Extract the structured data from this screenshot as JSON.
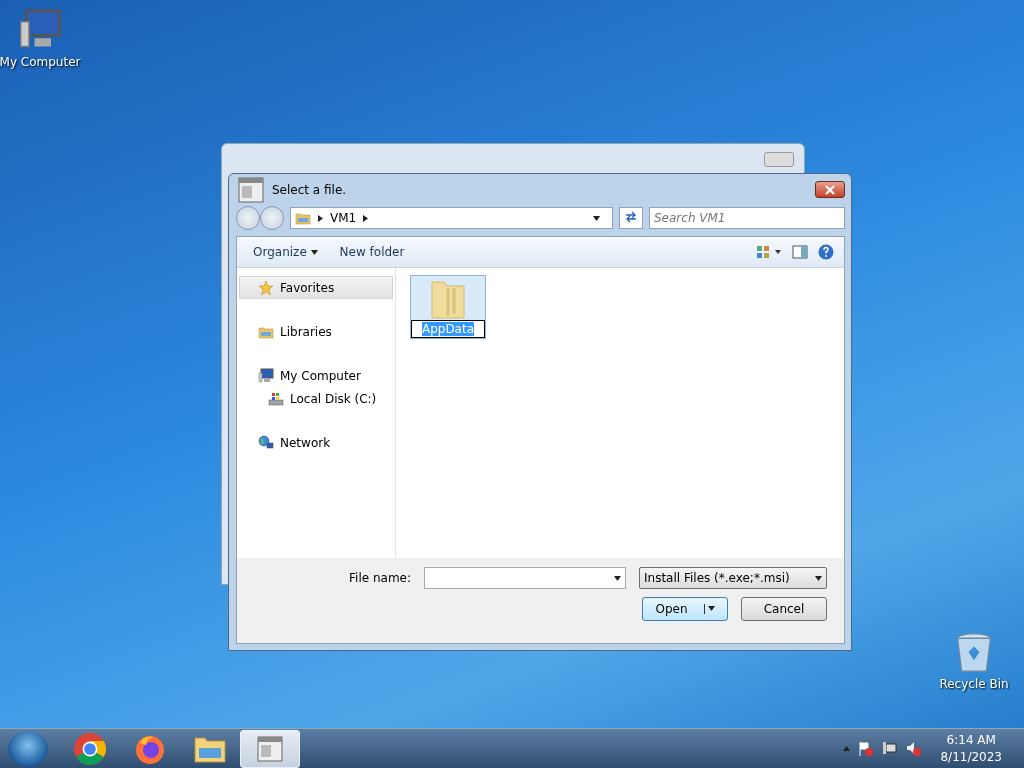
{
  "desktop_icons": [
    {
      "label": "My Computer",
      "kind": "computer"
    },
    {
      "label": "Recycle Bin",
      "kind": "recycle"
    }
  ],
  "dialog": {
    "title": "Select a file.",
    "breadcrumb": [
      "VM1"
    ],
    "search": {
      "placeholder": "Search VM1"
    },
    "toolbar": {
      "organize": "Organize",
      "new_folder": "New folder"
    },
    "nav": [
      {
        "label": "Favorites",
        "kind": "favorites",
        "selected": true
      },
      {
        "label": "Libraries",
        "kind": "libraries",
        "selected": false
      },
      {
        "label": "My Computer",
        "kind": "computer",
        "selected": false,
        "children": [
          {
            "label": "Local Disk (C:)",
            "kind": "disk",
            "selected": false
          }
        ]
      },
      {
        "label": "Network",
        "kind": "network",
        "selected": false
      }
    ],
    "files": [
      {
        "name": "AppData",
        "selected": true
      }
    ],
    "file_name": {
      "label": "File name:"
    },
    "file_type": "Install Files (*.exe;*.msi)",
    "open_button": "Open",
    "cancel_button": "Cancel"
  },
  "taskbar": {
    "apps": [
      {
        "kind": "chrome",
        "active": false
      },
      {
        "kind": "firefox",
        "active": false
      },
      {
        "kind": "explorer",
        "active": false
      },
      {
        "kind": "dialog",
        "active": true
      }
    ],
    "time": "6:14 AM",
    "date": "8/11/2023"
  }
}
